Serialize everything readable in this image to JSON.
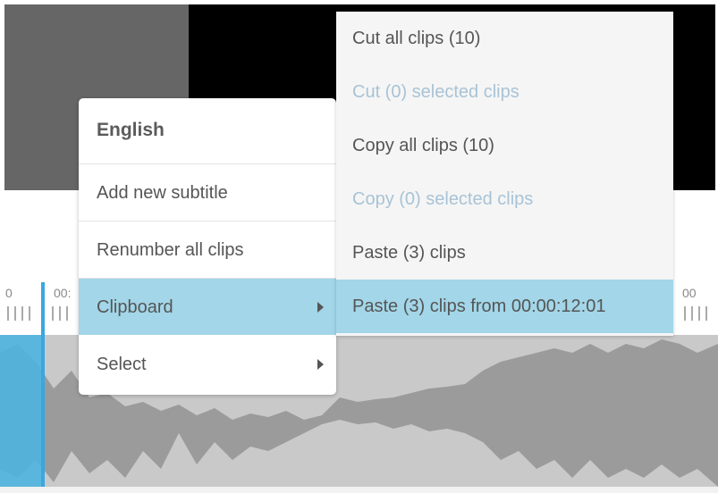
{
  "timeline": {
    "labels": [
      "0",
      "00:",
      "00"
    ]
  },
  "context_menu": {
    "header": "English",
    "items": [
      {
        "label": "Add new subtitle"
      },
      {
        "label": "Renumber all clips"
      },
      {
        "label": "Clipboard",
        "has_submenu": true,
        "active": true
      },
      {
        "label": "Select",
        "has_submenu": true
      }
    ]
  },
  "clipboard_submenu": {
    "items": [
      {
        "label": "Cut all clips (10)",
        "enabled": true
      },
      {
        "label": "Cut (0) selected clips",
        "enabled": false
      },
      {
        "label": "Copy all clips (10)",
        "enabled": true
      },
      {
        "label": "Copy (0) selected clips",
        "enabled": false
      },
      {
        "label": "Paste (3) clips",
        "enabled": true
      },
      {
        "label": "Paste (3) clips from 00:00:12:01",
        "enabled": true,
        "active": true
      }
    ]
  },
  "colors": {
    "highlight": "#a2d6e8",
    "disabled_text": "#a8c3d6",
    "playhead": "#3aa7df",
    "waveform": "#c9c9c9"
  }
}
